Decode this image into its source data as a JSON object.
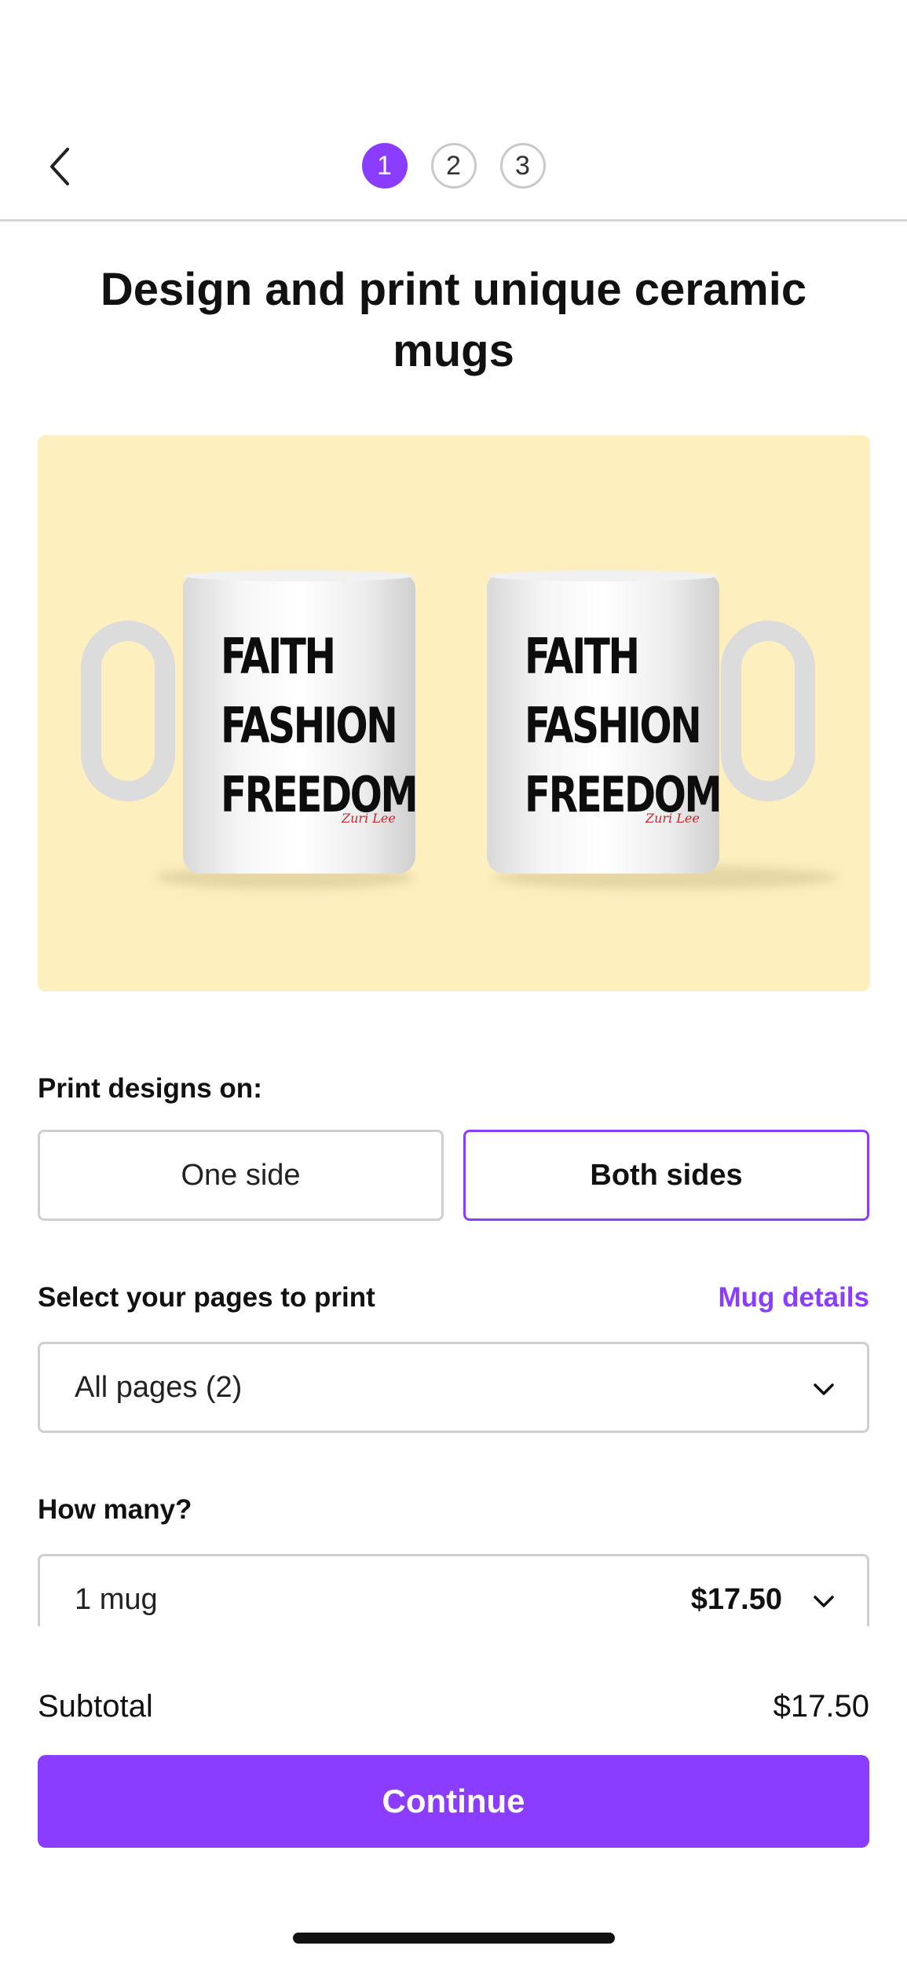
{
  "header": {
    "back_icon": "chevron-left-icon",
    "steps": [
      {
        "label": "1",
        "active": true
      },
      {
        "label": "2",
        "active": false
      },
      {
        "label": "3",
        "active": false
      }
    ]
  },
  "title": "Design and print unique ceramic mugs",
  "product_image": {
    "mug_text": [
      "FAITH",
      "FASHION",
      "FREEDOM"
    ],
    "signature": "Zuri Lee",
    "background_color": "#fdefbe"
  },
  "print_sides": {
    "label": "Print designs on:",
    "options": [
      {
        "label": "One side",
        "selected": false
      },
      {
        "label": "Both sides",
        "selected": true
      }
    ]
  },
  "pages": {
    "label": "Select your pages to print",
    "details_link": "Mug details",
    "selected": "All pages (2)"
  },
  "quantity": {
    "label": "How many?",
    "selected": "1 mug",
    "price": "$17.50"
  },
  "summary": {
    "subtotal_label": "Subtotal",
    "subtotal_value": "$17.50"
  },
  "continue_label": "Continue",
  "colors": {
    "accent": "#8b3dff",
    "border": "#cfcfcf",
    "text": "#111111"
  }
}
